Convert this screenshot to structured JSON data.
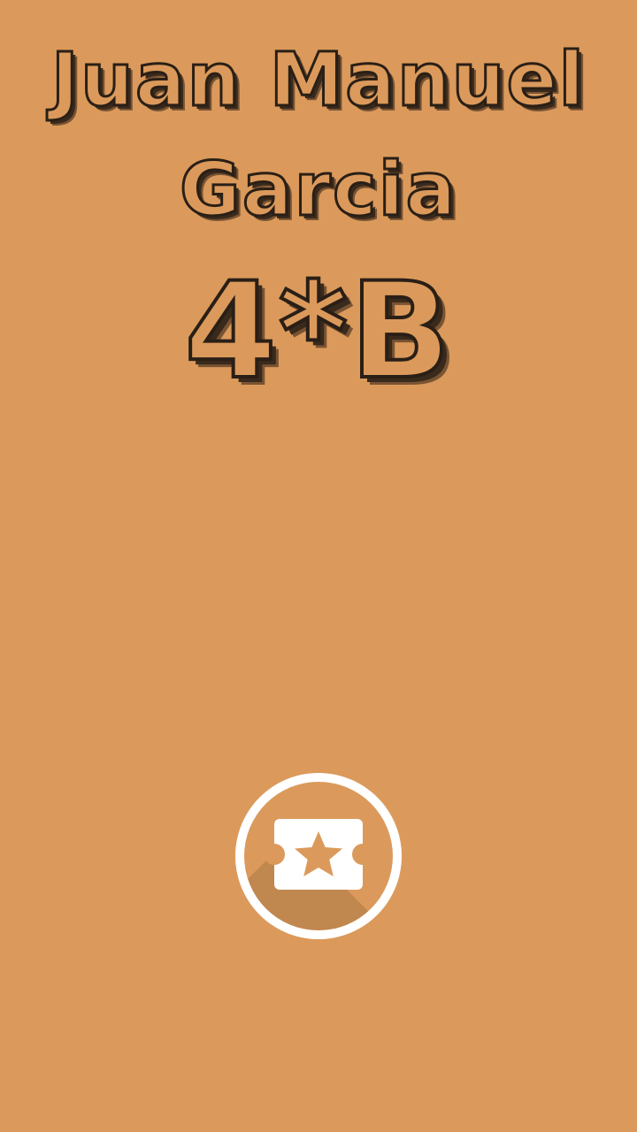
{
  "profile": {
    "name_line_1": "Juan Manuel",
    "name_line_2": "Garcia",
    "grade": "4*B"
  },
  "launcher": {
    "icon": "ticket-star-icon"
  },
  "colors": {
    "background": "#DB9A5B",
    "text_outline": "#2a1f16",
    "icon_white": "#ffffff"
  }
}
